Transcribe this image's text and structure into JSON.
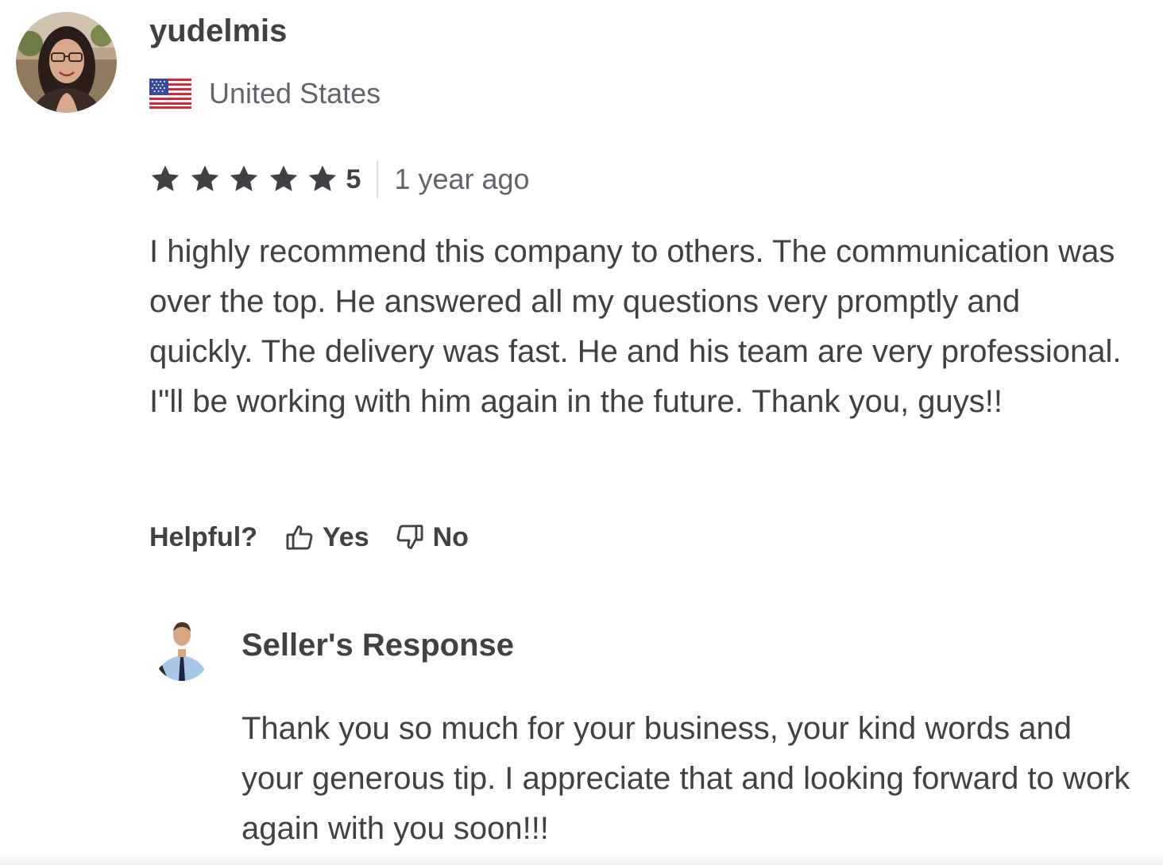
{
  "review": {
    "username": "yudelmis",
    "country": "United States",
    "country_flag_icon": "us-flag-icon",
    "rating": "5",
    "star_count": 5,
    "time_ago": "1 year ago",
    "text": "I highly recommend this company to others. The communication was over the top. He answered all my questions very promptly and quickly. The delivery was fast. He and his team are very professional. I\"ll be working with him again in the future. Thank you, guys!!",
    "helpful": {
      "label": "Helpful?",
      "yes_label": "Yes",
      "no_label": "No",
      "yes_icon": "thumbs-up-icon",
      "no_icon": "thumbs-down-icon"
    }
  },
  "seller_response": {
    "title": "Seller's Response",
    "text": "Thank you so much for your business, your kind words and your generous tip. I appreciate that and looking forward to work again with you soon!!!"
  },
  "colors": {
    "text_primary": "#404145",
    "text_secondary": "#62646a",
    "star": "#404145",
    "divider": "#dadbdd"
  }
}
